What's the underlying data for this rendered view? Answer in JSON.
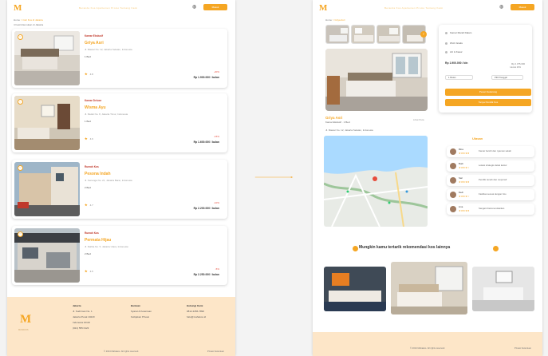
{
  "left": {
    "brand": "M",
    "nav_links": "Beranda     Kos     Apartemen     Promo     Tentang Kami",
    "nav_button": "Masuk",
    "breadcrumb_home": "Home",
    "breadcrumb_current": "> Cari Kos di Jakarta",
    "result_count": "4 hasil ditemukan di Jakarta",
    "listings": [
      {
        "type": "Kamar Ekslusif",
        "name": "Griya Asri",
        "addr": "Jl. Mawar No. 12, Jakarta Selatan, Indonesia",
        "unit": "1 Bed",
        "rating": "★",
        "reviews": "4.8",
        "disc": "-20%",
        "price": "Rp 1.900.000 / bulan"
      },
      {
        "type": "Kamar Deluxe",
        "name": "Wisma Ayu",
        "addr": "Jl. Melati No. 8, Jakarta Timur, Indonesia",
        "unit": "1 Bed",
        "rating": "★",
        "reviews": "4.6",
        "disc": "-15%",
        "price": "Rp 1.600.000 / bulan"
      },
      {
        "type": "Rumah Kos",
        "name": "Pesona Indah",
        "addr": "Jl. Kenanga No. 21, Jakarta Barat, Indonesia",
        "unit": "2 Bed",
        "rating": "★",
        "reviews": "4.7",
        "disc": "-10%",
        "price": "Rp 2.200.000 / bulan"
      },
      {
        "type": "Rumah Kos",
        "name": "Permata Hijau",
        "addr": "Jl. Dahlia No. 5, Jakarta Utara, Indonesia",
        "unit": "2 Bed",
        "rating": "★",
        "reviews": "4.5",
        "disc": "-5%",
        "price": "Rp 2.250.000 / bulan"
      }
    ],
    "footer": {
      "brand": "M",
      "tagline": "MAHAKOS",
      "col1_title": "Jakarta",
      "col1_lines": [
        "Jl. Sudirman No. 1",
        "Jakarta Pusat 10220",
        "Indonesia 10110",
        "(021) 555 0123"
      ],
      "col2_title": "Bantuan",
      "col2_lines": [
        "Syarat & Ketentuan",
        "Kebijakan Privasi"
      ],
      "col3_title": "Hubungi Kami",
      "col3_lines": [
        "0812-3456-7890",
        "halo@mahakos.id"
      ],
      "copyright": "© 2024 Mahakos. All rights reserved.",
      "links": "Privasi     Ketentuan"
    }
  },
  "right": {
    "brand": "M",
    "nav_links": "Beranda     Kos     Apartemen     Promo     Tentang Kami",
    "nav_button": "Masuk",
    "breadcrumb_home": "Home",
    "breadcrumb_current": "> Griya Asri",
    "property_name": "Griya Asri",
    "property_meta": "Kamar Ekslusif · 1 Bed",
    "property_meta_right": "Lihat Peta",
    "property_addr": "Jl. Mawar No. 12, Jakarta Selatan, Indonesia",
    "booking": {
      "rows": [
        "Kamar Mandi Dalam",
        "Wi-Fi Gratis",
        "AC & Kasur"
      ],
      "price": "Rp 1.900.000 / bln",
      "price_right": "Rp 2.375.000",
      "small": "Hemat 20%",
      "select_duration": "1 Bulan",
      "select_date": "Pilih Tanggal",
      "btn_primary": "Pesan Sekarang",
      "btn_secondary": "Tanya Pemilik Kos"
    },
    "reviews_title": "Ulasan",
    "reviews": [
      {
        "name": "Rina",
        "stars": "★★★★★",
        "text": "Kamar bersih dan nyaman sekali"
      },
      {
        "name": "Budi",
        "stars": "★★★★☆",
        "text": "Lokasi strategis dekat kantor"
      },
      {
        "name": "Sari",
        "stars": "★★★★★",
        "text": "Pemilik ramah dan responsif"
      },
      {
        "name": "Dedi",
        "stars": "★★★★☆",
        "text": "Fasilitas sesuai dengan foto"
      },
      {
        "name": "Lina",
        "stars": "★★★★★",
        "text": "Sangat direkomendasikan"
      }
    ],
    "recommend_title": "Mungkin kamu tertarik rekomendasi kos lainnya",
    "footer_copyright": "© 2024 Mahakos. All rights reserved.",
    "footer_links": "Privasi     Ketentuan"
  },
  "colors": {
    "accent": "#f5a623",
    "footer_bg": "#fde6c8"
  }
}
